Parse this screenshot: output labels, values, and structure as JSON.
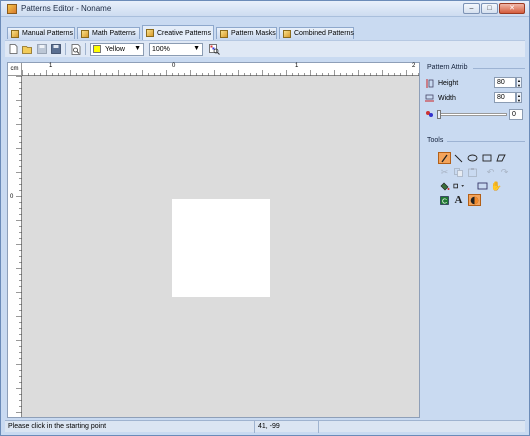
{
  "window": {
    "title": "Patterns Editor - Noname",
    "controls": {
      "minimize": "–",
      "maximize": "□",
      "close": "✕"
    }
  },
  "tabs": [
    {
      "label": "Manual Patterns",
      "active": false
    },
    {
      "label": "Math Patterns",
      "active": false
    },
    {
      "label": "Creative Patterns",
      "active": true
    },
    {
      "label": "Pattern Masks",
      "active": false
    },
    {
      "label": "Combined Patterns",
      "active": false
    }
  ],
  "toolbar": {
    "buttons": [
      "new-file-icon",
      "open-folder-icon",
      "save-icon",
      "save-as-icon",
      "print-preview-icon"
    ],
    "color": {
      "label": "Yellow",
      "swatch": "#ffff00"
    },
    "zoom": "100%",
    "extra_button": "preview-pattern-icon"
  },
  "rulers": {
    "unit": "cm",
    "horizontal": [
      "1",
      "0",
      "1",
      "2"
    ],
    "vertical": [
      "0"
    ]
  },
  "pattern_attrib": {
    "title": "Pattern Attrib",
    "height_label": "Height",
    "height_value": "80",
    "width_label": "Width",
    "width_value": "80",
    "slider_value": "0"
  },
  "tools": {
    "title": "Tools",
    "text_tool": "A"
  },
  "status": {
    "message": "Please click in the starting point",
    "coords": "41, -99"
  }
}
